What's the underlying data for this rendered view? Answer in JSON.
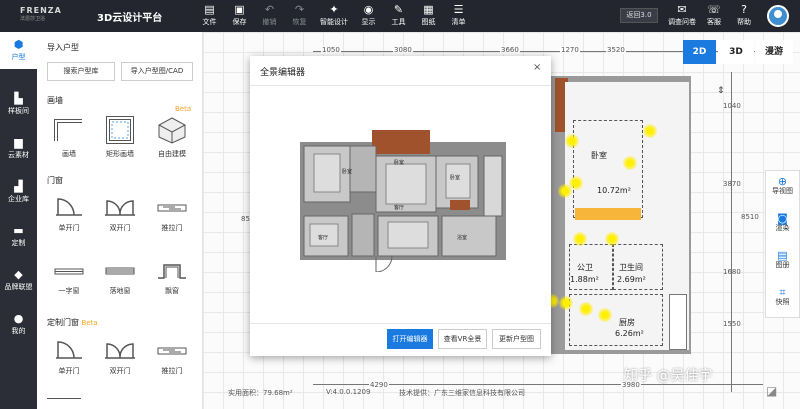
{
  "app": {
    "logo_brand": "FRENZA",
    "logo_sub": "法恩莎卫浴",
    "title": "3D云设计平台"
  },
  "toolbar": {
    "items": [
      {
        "label": "文件",
        "icon": "file-icon"
      },
      {
        "label": "保存",
        "icon": "save-icon"
      },
      {
        "label": "撤销",
        "icon": "undo-icon"
      },
      {
        "label": "恢复",
        "icon": "redo-icon"
      },
      {
        "label": "智能设计",
        "icon": "smart-design-icon"
      },
      {
        "label": "显示",
        "icon": "display-icon"
      },
      {
        "label": "工具",
        "icon": "tools-icon"
      },
      {
        "label": "图纸",
        "icon": "drawing-icon"
      },
      {
        "label": "清单",
        "icon": "list-icon"
      }
    ],
    "return_label": "返回3.0",
    "right": [
      {
        "label": "调查问卷",
        "icon": "survey-icon"
      },
      {
        "label": "客服",
        "icon": "service-icon"
      },
      {
        "label": "帮助",
        "icon": "help-icon"
      }
    ]
  },
  "leftnav": [
    {
      "label": "户型",
      "icon": "floorplan-icon",
      "active": true
    },
    {
      "label": "样板间",
      "icon": "showroom-icon"
    },
    {
      "label": "云素材",
      "icon": "cloud-material-icon"
    },
    {
      "label": "企业库",
      "icon": "enterprise-icon"
    },
    {
      "label": "定制",
      "icon": "custom-icon"
    },
    {
      "label": "品牌联盟",
      "icon": "brand-icon"
    },
    {
      "label": "我的",
      "icon": "user-icon"
    }
  ],
  "panel": {
    "import_title": "导入户型",
    "search_btn": "搜索户型库",
    "import_btn": "导入户型图/CAD",
    "wall_title": "画墙",
    "wall_beta": "Beta",
    "wall_items": [
      "画墙",
      "矩形画墙",
      "自由建模"
    ],
    "door_title": "门窗",
    "door_items": [
      "单开门",
      "双开门",
      "推拉门",
      "一字窗",
      "落地窗",
      "飘窗"
    ],
    "custom_title": "定制门窗",
    "custom_beta": "Beta",
    "custom_items": [
      "单开门",
      "双开门",
      "推拉门"
    ]
  },
  "canvas": {
    "views": [
      "2D",
      "3D",
      "漫游"
    ],
    "active_view": "2D",
    "top_dims": [
      "1050",
      "3080",
      "3660",
      "1270",
      "3520"
    ],
    "right_dims": [
      "1040",
      "3870",
      "8510",
      "1680",
      "1550"
    ],
    "left_dim": "85",
    "bottom_dims": [
      "4290",
      "3980"
    ],
    "rooms": [
      {
        "name": "卧室",
        "area": "10.72m²"
      },
      {
        "name": "公卫",
        "area": "1.88m²"
      },
      {
        "name": "卫生间",
        "area": "2.69m²"
      },
      {
        "name": "厨房",
        "area": "6.26m²"
      }
    ],
    "side_tools": [
      {
        "label": "导视图",
        "icon": "guide-view-icon"
      },
      {
        "label": "渲染",
        "icon": "camera-icon"
      },
      {
        "label": "图册",
        "icon": "album-icon"
      },
      {
        "label": "快照",
        "icon": "snapshot-icon"
      }
    ]
  },
  "modal": {
    "title": "全景编辑器",
    "close": "×",
    "buttons": [
      "打开编辑器",
      "查看VR全景",
      "更新户型图"
    ],
    "plan_labels": [
      "卧室",
      "卧室",
      "卧室",
      "客厅",
      "客厅",
      "浴室"
    ]
  },
  "footer": {
    "area": "实用面积：79.68m²",
    "version": "V:4.0.0.1209",
    "support": "技术提供：广东三维家信息科技有限公司"
  },
  "watermark": "知乎 @吴佳宇"
}
